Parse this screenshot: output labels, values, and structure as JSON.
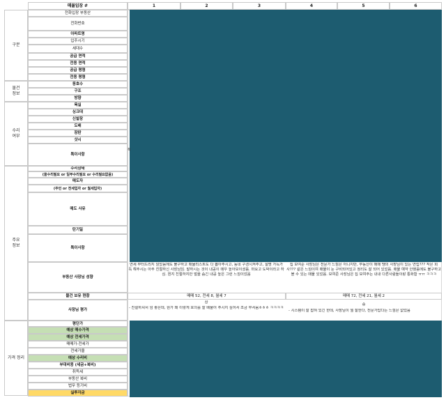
{
  "header": {
    "title": "매물입장 #",
    "columns": [
      "1",
      "2",
      "3",
      "4",
      "5",
      "6"
    ]
  },
  "groups": {
    "g1": "구분",
    "g2": "물건\n정보",
    "g3": "수리\n여부",
    "g4": "주요\n정보",
    "g5": "가격 정리"
  },
  "rows": {
    "r1": "전화입장 부동산",
    "r2": "전화번호",
    "r3": "아파트명",
    "r4": "입주시기",
    "r5": "세대수",
    "r6": "공급 면적",
    "r7": "전용 면적",
    "r8": "공급 평형",
    "r9": "전용 평형",
    "r10": "동호수",
    "r11": "구조",
    "r12": "방향",
    "r13": "욕실",
    "r14": "싱크대",
    "r15": "신발장",
    "r16": "도배",
    "r17": "장판",
    "r18": "샷시",
    "r19": "특이사항",
    "r20a": "수리상태",
    "r20b": "(올수리필요 or 일부수리필요 or 수리필요없음)",
    "r21a": "매도자",
    "r21b": "(주인 or 전세입자 or 월세입자)",
    "r22": "매도 사유",
    "r23": "탄기일",
    "r24": "특이사항",
    "r25": "부동산 사장님 성향",
    "r26": "물건 보유 현황",
    "r27": "사장님 평가",
    "p1": "평단가",
    "p2": "예상 매수가격",
    "p3": "예상 전세가격",
    "p4": "매매가-전세가",
    "p5": "전세가율",
    "p6": "예상 수리비",
    "p7": "부대비용 (세금+복비)",
    "p8": "취득세",
    "p9": "부동산 복비",
    "p10": "법무 등기비",
    "p11": "실투자금"
  },
  "notes": {
    "col1_tendency": "연세 부터드리지 않았음에도 불구하고 매물리스트도 다 뽑아주시고, 동네 구경시켜주고, 설명 가득가득 해주시는 아주 친절하신 사장님임. 말하시는 것이 내공이 매우 높아보이셨음. 마요고 도박이라고 하심. 뭔지 친절하지만 벌을 숨긴 내공 높은 그런 느낌이었음",
    "col4_tendency": "집 보여준 사장님은 전문가 느낌은 아니지만, 부동산이 매매 땡의 사장님이 있는 연립??? 작은 회사??? 같은 느낌이여 매물이 눈 구비되어있고 정리도 잘 되어 있었음. 매물 예약 안했음에도 불구하고 볼 수 있는 매물 있었음. 보여준 사장님은 집 보여주는 내내 다른사람들이랑 통화함 ㅠㅠ ㅋㅋㅋ",
    "col1_holdings": "매매 52, 전세 8, 월세 7",
    "col4_holdings": "매매 72, 전세 21, 월세 2",
    "col1_grade": "상",
    "col1_eval": "- 친절하셔서 넘 좋은데, 뭔가 왜 이렇게 호의를 잘 베풀어 주시지 싶어서 조금 무서움ㅎㅎㅎ ㅋㅋㅋㅋ",
    "col4_grade": "중",
    "col4_eval": "- 시스템이 잘 잡혀 있긴 한데, 사장님이 뭘 잘한다, 전문가답다는 느낌은 없었음",
    "side_fragment": "특"
  },
  "colors": {
    "teal": "#1d5c70",
    "green": "#c5dfb4",
    "yellow": "#ffd966"
  }
}
